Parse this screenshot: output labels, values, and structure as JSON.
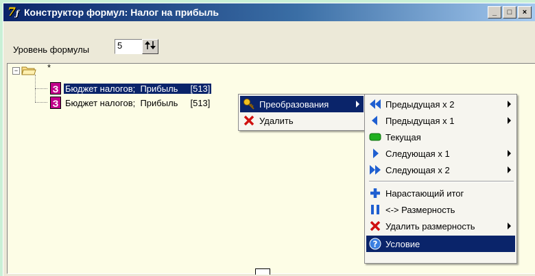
{
  "window": {
    "title": "Конструктор формул: Налог на прибыль",
    "controls": [
      "_",
      "□",
      "×"
    ]
  },
  "level": {
    "label": "Уровень формулы",
    "value": "5"
  },
  "tree": {
    "root_label": "*",
    "nodes": [
      {
        "text": "Бюджет налогов;  Прибыль     [513]",
        "selected": true
      },
      {
        "text": "Бюджет налогов;  Прибыль     [513]",
        "selected": false
      }
    ]
  },
  "context_menu": {
    "items": [
      {
        "label": "Преобразования",
        "icon": "key-icon"
      },
      {
        "label": "Удалить",
        "icon": "delete-x-icon"
      }
    ]
  },
  "submenu": {
    "items": [
      {
        "label": "Предыдущая х 2",
        "icon": "double-left-arrow-icon"
      },
      {
        "label": "Предыдущая х 1",
        "icon": "left-arrow-icon"
      },
      {
        "label": "Текущая",
        "icon": "current-green-icon"
      },
      {
        "label": "Следующая х 1",
        "icon": "right-arrow-icon"
      },
      {
        "label": "Следующая х 2",
        "icon": "double-right-arrow-icon"
      },
      {
        "label": "Нарастающий итог",
        "icon": "plus-icon"
      },
      {
        "label": "<-> Размерность",
        "icon": "pause-bars-icon"
      },
      {
        "label": "Удалить размерность",
        "icon": "delete-x-icon"
      },
      {
        "label": "Условие",
        "icon": "help-circle-icon"
      }
    ]
  },
  "colors": {
    "titlebar": "#0a246a",
    "selection": "#0a246a",
    "node_icon": "#c0008a",
    "tree_bg": "#fdfde6"
  }
}
